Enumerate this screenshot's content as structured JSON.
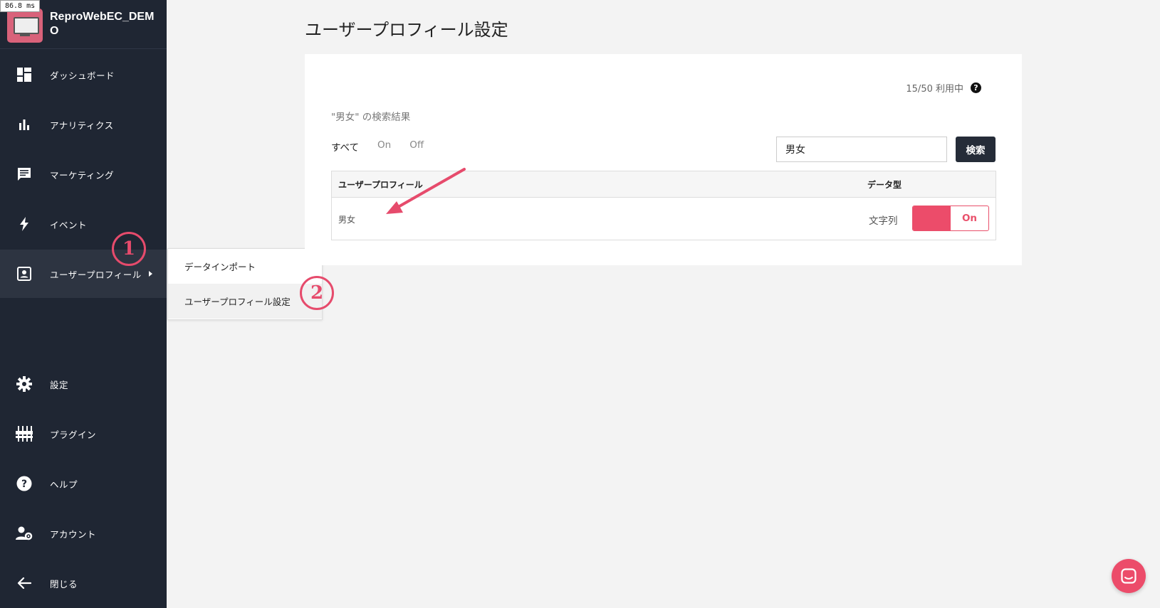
{
  "perf_badge": "86.8 ms",
  "app": {
    "name": "ReproWebEC_DEMO"
  },
  "sidebar": {
    "items": [
      {
        "label": "ダッシュボード",
        "icon": "dashboard-icon"
      },
      {
        "label": "アナリティクス",
        "icon": "bar-chart-icon"
      },
      {
        "label": "マーケティング",
        "icon": "message-icon"
      },
      {
        "label": "イベント",
        "icon": "lightning-icon"
      },
      {
        "label": "ユーザープロフィール",
        "icon": "profile-icon"
      },
      {
        "label": "設定",
        "icon": "gear-icon"
      },
      {
        "label": "プラグイン",
        "icon": "plugin-icon"
      },
      {
        "label": "ヘルプ",
        "icon": "help-icon"
      },
      {
        "label": "アカウント",
        "icon": "account-icon"
      },
      {
        "label": "閉じる",
        "icon": "arrow-left-icon"
      }
    ]
  },
  "submenu": {
    "items": [
      {
        "label": "データインポート"
      },
      {
        "label": "ユーザープロフィール設定"
      }
    ]
  },
  "annotations": {
    "one": "1",
    "two": "2",
    "color": "#e64b6c"
  },
  "main": {
    "title": "ユーザープロフィール設定",
    "usage": "15/50 利用中",
    "help": "?",
    "results_caption": "\"男女\" の検索結果",
    "filters": [
      "すべて",
      "On",
      "Off"
    ],
    "search": {
      "value": "男女",
      "button": "検索"
    },
    "table": {
      "headers": [
        "ユーザープロフィール",
        "データ型"
      ],
      "rows": [
        {
          "name": "男女",
          "type": "文字列",
          "toggle": "On"
        }
      ]
    }
  },
  "colors": {
    "accent": "#ec4c6a",
    "sidebar": "#1f2633",
    "button_dark": "#252c38"
  }
}
